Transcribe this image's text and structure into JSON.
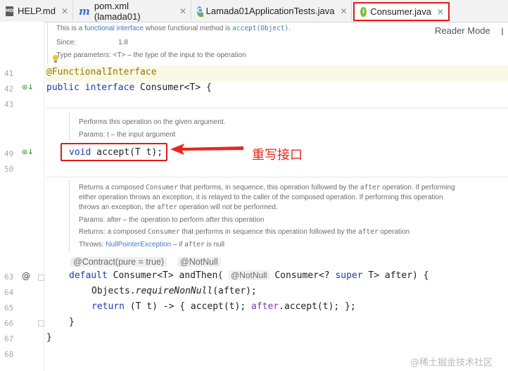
{
  "tabs": [
    {
      "label": "HELP.md",
      "icon": "markdown-icon",
      "close": "✕"
    },
    {
      "label": "pom.xml (lamada01)",
      "icon": "maven-icon",
      "close": "✕"
    },
    {
      "label": "Lamada01ApplicationTests.java",
      "icon": "java-class-icon",
      "close": "✕"
    },
    {
      "label": "Consumer.java",
      "icon": "java-interface-icon",
      "close": "✕"
    }
  ],
  "reader_mode": "Reader Mode",
  "top_doc": {
    "desc_pre": "This is a ",
    "desc_link": "functional interface",
    "desc_mid": " whose functional method is ",
    "desc_code": "accept(Object)",
    "desc_post": ".",
    "since_label": "Since:",
    "since_value": "1.8",
    "type_params": "Type parameters:  <T> – the type of the input to the operation"
  },
  "line_numbers": [
    "41",
    "42",
    "43",
    "49",
    "50",
    "63",
    "64",
    "65",
    "66",
    "67",
    "68"
  ],
  "code": {
    "l41": "@FunctionalInterface",
    "l42_kw": "public interface",
    "l42_rest": " Consumer<T> {",
    "l49_kw": "void",
    "l49_rest": " accept(T t);",
    "l63_kw": "default",
    "l63_a": " Consumer<T> ",
    "l63_method": "andThen(",
    "l63_inlay": "@NotNull",
    "l63_b": " Consumer<? ",
    "l63_super": "super",
    "l63_c": " T> after) {",
    "l64_a": "Objects.",
    "l64_it": "requireNonNull",
    "l64_b": "(after);",
    "l65_kw": "return",
    "l65_a": " (T t) -> { accept(t); ",
    "l65_after": "after",
    "l65_b": ".accept(t); };",
    "l66": "}",
    "l67": "}"
  },
  "accept_doc": {
    "desc": "Performs this operation on the given argument.",
    "params": "Params:  t – the input argument"
  },
  "andthen_doc": {
    "line1_pre": "Returns a composed ",
    "line1_code": "Consumer",
    "line1_mid": " that performs, in sequence, this operation followed by the ",
    "line1_code2": "after",
    "line1_post": " operation. If performing",
    "line2": "either operation throws an exception, it is relayed to the caller of the composed operation. If performing this operation",
    "line3_pre": "throws an exception, the ",
    "line3_code": "after",
    "line3_post": " operation will not be performed.",
    "params": "Params:  after – the operation to perform after this operation",
    "returns_pre": "Returns:  a composed ",
    "returns_code": "Consumer",
    "returns_mid": " that performs in sequence this operation followed by the ",
    "returns_code2": "after",
    "returns_post": " operation",
    "throws_label": "Throws:  ",
    "throws_link": "NullPointerException",
    "throws_mid": " – if ",
    "throws_code": "after",
    "throws_post": " is null"
  },
  "inlays": {
    "contract": "@Contract(pure = true)",
    "notnull": "@NotNull"
  },
  "annotation_text": "重写接口",
  "watermark": "@稀土掘金技术社区",
  "colors": {
    "highlight_red": "#e01a1a",
    "keyword_blue": "#1f3ea8",
    "annotation_gold": "#8f7a00"
  }
}
